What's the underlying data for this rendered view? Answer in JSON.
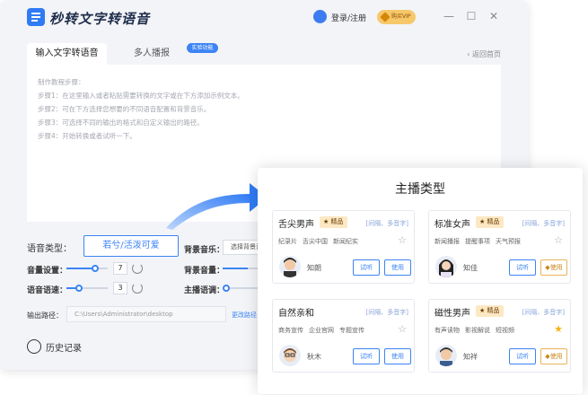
{
  "app": {
    "title": "秒转文字转语音",
    "login": "登录/注册",
    "vip": "购买VIP"
  },
  "window": {
    "minimize": "—",
    "maximize": "☐",
    "close": "✕"
  },
  "tabs": [
    {
      "label": "输入文字转语音"
    },
    {
      "label": "多人播报"
    }
  ],
  "tab_badge": "实验功能",
  "back": "返回首页",
  "editor_lines": [
    "制作教程步骤：",
    "步骤1：在这里输入或者粘贴需要转换的文字或在下方添加示例文本。",
    "步骤2：可在下方选择您想要的不同语音配置和背景音乐。",
    "步骤3：可选择不同的输出的格式和自定义输出的路径。",
    "步骤4：开始转换或者试听一下。"
  ],
  "settings": {
    "voice_type_label": "语音类型：",
    "voice_type_value": "若兮/活泼可爱",
    "bgm_label": "背景音乐：",
    "bgm_value": "选择背景音乐",
    "volume_label": "音量设置：",
    "volume_value": "7",
    "volume_level": 0.7,
    "bg_volume_label": "背景音量：",
    "speed_label": "语音语速：",
    "speed_value": "3",
    "speed_level": 0.3,
    "tone_label": "主播语调：",
    "output_label": "输出路径：",
    "output_path": "C:\\Users\\Administrator\\desktop",
    "change_path": "更改路径"
  },
  "history": "历史记录",
  "panel": {
    "title": "主播类型",
    "cards": [
      {
        "name": "舌尖男声",
        "badge": "精品",
        "modes": "[间隔、多音字]",
        "tags": [
          "纪录片",
          "舌尖中国",
          "新闻纪实"
        ],
        "voice": "知朗",
        "listen": "试听",
        "use": "使用",
        "favorite": false
      },
      {
        "name": "标准女声",
        "badge": "精品",
        "modes": "[间隔、多音字]",
        "tags": [
          "新闻播报",
          "提醒事项",
          "天气预报"
        ],
        "voice": "知佳",
        "listen": "试听",
        "use": "使用",
        "favorite": false
      },
      {
        "name": "自然亲和",
        "badge": "",
        "modes": "[间隔、多音字]",
        "tags": [
          "商务宣传",
          "企业官网",
          "专题宣传"
        ],
        "voice": "秋木",
        "listen": "试听",
        "use": "使用",
        "favorite": false
      },
      {
        "name": "磁性男声",
        "badge": "精品",
        "modes": "[间隔、多音字]",
        "tags": [
          "有声读物",
          "影视解说",
          "短视频"
        ],
        "voice": "知祥",
        "listen": "试听",
        "use": "使用",
        "favorite": true
      }
    ]
  },
  "colors": {
    "accent": "#3c84f5",
    "gold": "#f7c86a"
  }
}
